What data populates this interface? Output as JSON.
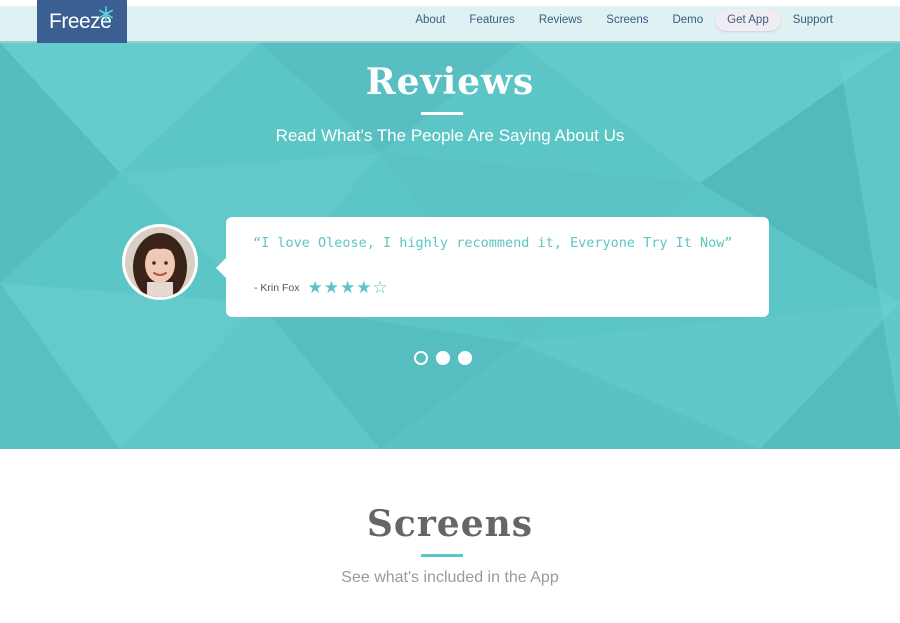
{
  "nav": {
    "logo": "Freeze",
    "items": [
      {
        "label": "About"
      },
      {
        "label": "Features"
      },
      {
        "label": "Reviews"
      },
      {
        "label": "Screens"
      },
      {
        "label": "Demo"
      },
      {
        "label": "Get App",
        "active": true
      },
      {
        "label": "Support"
      }
    ]
  },
  "reviews": {
    "title": "Reviews",
    "subtitle": "Read What's The People Are Saying About Us",
    "testimonial": {
      "quote": "“I love Oleose, I highly recommend it, Everyone Try It Now”",
      "author": "- Krin Fox",
      "rating": 4,
      "max_rating": 5
    },
    "carousel": {
      "slides": 3,
      "active_index": 0
    }
  },
  "screens": {
    "title": "Screens",
    "subtitle": "See what's included in the App"
  },
  "colors": {
    "accent": "#5cc5c6",
    "logo_bg": "#3b5f93",
    "nav_text": "#3d5a80",
    "nav_bg": "#dff1f3"
  },
  "icons": {
    "logo": "snowflake-icon",
    "rating_full": "star-filled-icon",
    "rating_empty": "star-outline-icon"
  }
}
